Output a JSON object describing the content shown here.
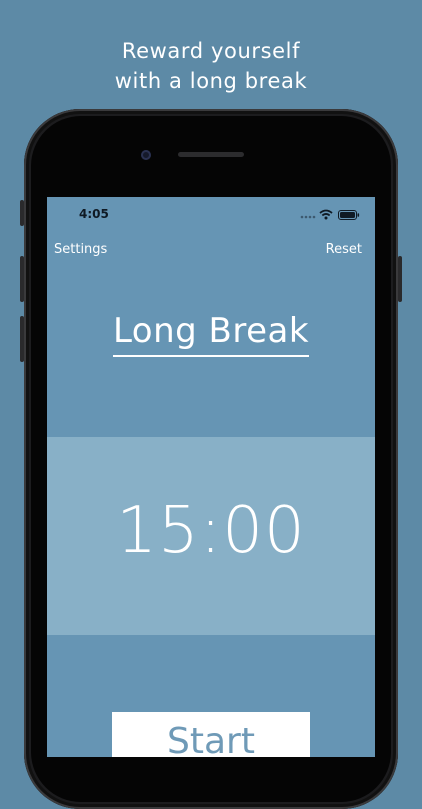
{
  "headline": {
    "line1": "Reward yourself",
    "line2": "with a long break"
  },
  "status_bar": {
    "time": "4:05",
    "signal_icon": "cellular-signal-icon",
    "wifi_icon": "wifi-icon",
    "battery_icon": "battery-icon"
  },
  "nav": {
    "left_label": "Settings",
    "right_label": "Reset"
  },
  "mode": {
    "title": "Long Break"
  },
  "timer": {
    "value": "15:00"
  },
  "actions": {
    "start_label": "Start"
  },
  "colors": {
    "background": "#5d8aa6",
    "screen": "#6695b4",
    "timer_panel": "#88b0c7",
    "button_text": "#6f9ab7"
  }
}
